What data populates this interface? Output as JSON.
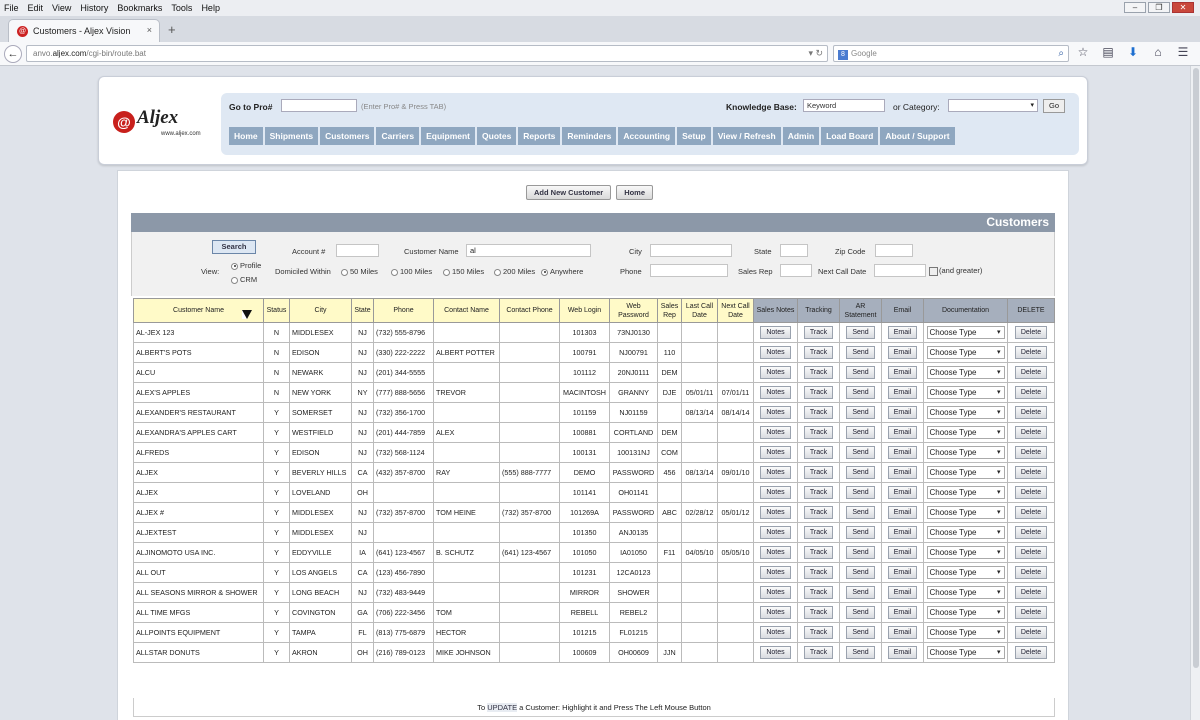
{
  "browser": {
    "menu": [
      "File",
      "Edit",
      "View",
      "History",
      "Bookmarks",
      "Tools",
      "Help"
    ],
    "tab_title": "Customers - Aljex Vision",
    "url_prefix": "anvo.",
    "url_domain": "aljex.com",
    "url_path": "/cgi-bin/route.bat",
    "search_placeholder": "Google",
    "window_controls": [
      "minimize",
      "restore",
      "close"
    ]
  },
  "header": {
    "logo_name": "Aljex",
    "logo_site": "www.aljex.com",
    "goto_label": "Go to Pro#",
    "goto_hint": "(Enter Pro# & Press TAB)",
    "kb_label": "Knowledge Base:",
    "kb_value": "Keyword",
    "category_label": "or Category:",
    "go_label": "Go",
    "nav": [
      "Home",
      "Shipments",
      "Customers",
      "Carriers",
      "Equipment",
      "Quotes",
      "Reports",
      "Reminders",
      "Accounting",
      "Setup",
      "View / Refresh",
      "Admin",
      "Load Board",
      "About / Support"
    ]
  },
  "page": {
    "add_customer": "Add New Customer",
    "home": "Home",
    "section_title": "Customers"
  },
  "search": {
    "button": "Search",
    "view_label": "View:",
    "view_profile": "Profile",
    "view_crm": "CRM",
    "account_label": "Account #",
    "customer_label": "Customer Name",
    "customer_value": "al",
    "city_label": "City",
    "state_label": "State",
    "zip_label": "Zip Code",
    "domiciled_label": "Domiciled Within",
    "radius": [
      "50 Miles",
      "100 Miles",
      "150 Miles",
      "200 Miles",
      "Anywhere"
    ],
    "phone_label": "Phone",
    "salesrep_label": "Sales Rep",
    "nextcall_label": "Next Call Date",
    "greater_label": "(and greater)"
  },
  "table": {
    "headers": [
      "Customer Name",
      "Status",
      "City",
      "State",
      "Phone",
      "Contact Name",
      "Contact Phone",
      "Web Login",
      "Web Password",
      "Sales Rep",
      "Last Call Date",
      "Next Call Date",
      "Sales Notes",
      "Tracking",
      "AR Statement",
      "Email",
      "Documentation",
      "DELETE"
    ],
    "btn_notes": "Notes",
    "btn_track": "Track",
    "btn_send": "Send",
    "btn_email": "Email",
    "btn_choose": "Choose Type",
    "btn_delete": "Delete",
    "rows": [
      [
        "AL-JEX 123",
        "N",
        "MIDDLESEX",
        "NJ",
        "(732) 555-8796",
        "",
        "",
        "101303",
        "73NJ0130",
        "",
        "",
        ""
      ],
      [
        "ALBERT'S POTS",
        "N",
        "EDISON",
        "NJ",
        "(330) 222-2222",
        "ALBERT POTTER",
        "",
        "100791",
        "NJ00791",
        "110",
        "",
        ""
      ],
      [
        "ALCU",
        "N",
        "NEWARK",
        "NJ",
        "(201) 344-5555",
        "",
        "",
        "101112",
        "20NJ0111",
        "DEM",
        "",
        ""
      ],
      [
        "ALEX'S APPLES",
        "N",
        "NEW YORK",
        "NY",
        "(777) 888-5656",
        "TREVOR",
        "",
        "MACINTOSH",
        "GRANNY",
        "DJE",
        "05/01/11",
        "07/01/11"
      ],
      [
        "ALEXANDER'S RESTAURANT",
        "Y",
        "SOMERSET",
        "NJ",
        "(732) 356-1700",
        "",
        "",
        "101159",
        "NJ01159",
        "",
        "08/13/14",
        "08/14/14"
      ],
      [
        "ALEXANDRA'S APPLES CART",
        "Y",
        "WESTFIELD",
        "NJ",
        "(201) 444-7859",
        "ALEX",
        "",
        "100881",
        "CORTLAND",
        "DEM",
        "",
        ""
      ],
      [
        "ALFREDS",
        "Y",
        "EDISON",
        "NJ",
        "(732) 568-1124",
        "",
        "",
        "100131",
        "100131NJ",
        "COM",
        "",
        ""
      ],
      [
        "ALJEX",
        "Y",
        "BEVERLY HILLS",
        "CA",
        "(432) 357-8700",
        "RAY",
        "(555) 888-7777",
        "DEMO",
        "PASSWORD",
        "456",
        "08/13/14",
        "09/01/10"
      ],
      [
        "ALJEX",
        "Y",
        "LOVELAND",
        "OH",
        "",
        "",
        "",
        "101141",
        "OH01141",
        "",
        "",
        ""
      ],
      [
        "ALJEX #",
        "Y",
        "MIDDLESEX",
        "NJ",
        "(732) 357-8700",
        "TOM HEINE",
        "(732) 357-8700",
        "101269A",
        "PASSWORD",
        "ABC",
        "02/28/12",
        "05/01/12"
      ],
      [
        "ALJEXTEST",
        "Y",
        "MIDDLESEX",
        "NJ",
        "",
        "",
        "",
        "101350",
        "ANJ0135",
        "",
        "",
        ""
      ],
      [
        "ALJINOMOTO USA INC.",
        "Y",
        "EDDYVILLE",
        "IA",
        "(641) 123-4567",
        "B. SCHUTZ",
        "(641) 123-4567",
        "101050",
        "IA01050",
        "F11",
        "04/05/10",
        "05/05/10"
      ],
      [
        "ALL OUT",
        "Y",
        "LOS ANGELS",
        "CA",
        "(123) 456-7890",
        "",
        "",
        "101231",
        "12CA0123",
        "",
        "",
        ""
      ],
      [
        "ALL SEASONS MIRROR & SHOWER",
        "Y",
        "LONG BEACH",
        "NJ",
        "(732) 483-9449",
        "",
        "",
        "MIRROR",
        "SHOWER",
        "",
        "",
        ""
      ],
      [
        "ALL TIME MFGS",
        "Y",
        "COVINGTON",
        "GA",
        "(706) 222-3456",
        "TOM",
        "",
        "REBELL",
        "REBEL2",
        "",
        "",
        ""
      ],
      [
        "ALLPOINTS EQUIPMENT",
        "Y",
        "TAMPA",
        "FL",
        "(813) 775-6879",
        "HECTOR",
        "",
        "101215",
        "FL01215",
        "",
        "",
        ""
      ],
      [
        "ALLSTAR DONUTS",
        "Y",
        "AKRON",
        "OH",
        "(216) 789-0123",
        "MIKE JOHNSON",
        "",
        "100609",
        "OH00609",
        "JJN",
        "",
        ""
      ]
    ]
  },
  "footer": {
    "pre": "To",
    "highlight": "UPDATE",
    "post": "a Customer: Highlight it and Press The Left Mouse Button"
  },
  "colors": {
    "nav_button": "#8fa7c0",
    "header_panel": "#dfe8f3",
    "section_header": "#8c98a8",
    "table_header": "#fffac8",
    "table_header_dark": "#a6afbd"
  }
}
